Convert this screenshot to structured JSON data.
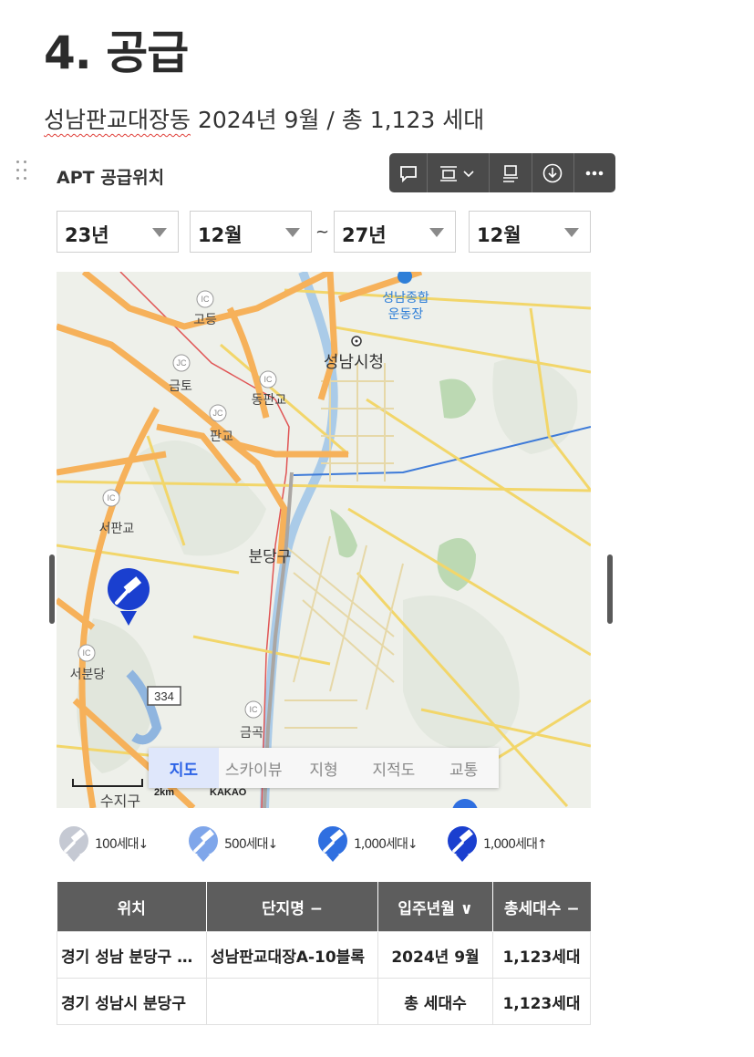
{
  "heading": {
    "title": "4. 공급",
    "subtitle_underlined": "성남판교대장동",
    "subtitle_rest": " 2024년 9월 / 총 1,123 세대"
  },
  "widget": {
    "title": "APT 공급위치"
  },
  "filters": {
    "from_year": "23년",
    "from_month": "12월",
    "separator": "~",
    "to_year": "27년",
    "to_month": "12월"
  },
  "map": {
    "labels": {
      "stadium": "성남종합\n운동장",
      "city_hall": "성남시청",
      "bundang": "분당구",
      "seopangyo": "서판교",
      "seobundang": "서분당",
      "godeung": "고등",
      "geumto": "금토",
      "dongpangyo": "동판교",
      "pangyo": "판교",
      "geumgok": "금곡",
      "suji": "수지구",
      "route": "334",
      "scale": "2km",
      "brand": "KAKAO"
    },
    "tabs": [
      "지도",
      "스카이뷰",
      "지형",
      "지적도",
      "교통"
    ],
    "active_tab": "지도"
  },
  "legend": [
    {
      "label": "100세대↓",
      "color": "#c5c9d3"
    },
    {
      "label": "500세대↓",
      "color": "#7fa6ea"
    },
    {
      "label": "1,000세대↓",
      "color": "#2f6fe0"
    },
    {
      "label": "1,000세대↑",
      "color": "#1a3fcf"
    }
  ],
  "table": {
    "headers": [
      "위치",
      "단지명 −",
      "입주년월 ∨",
      "총세대수 −"
    ],
    "rows": [
      [
        "경기 성남 분당구 대장동",
        "성남판교대장A-10블록",
        "2024년 9월",
        "1,123세대"
      ],
      [
        "경기 성남시 분당구",
        "",
        "총 세대수",
        "1,123세대"
      ]
    ]
  }
}
